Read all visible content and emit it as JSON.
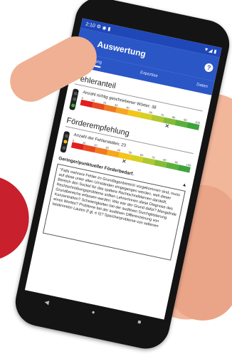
{
  "status": {
    "time": "2:10",
    "icons": "⚙ ◉ ▮",
    "right": "▼◢ ▮"
  },
  "appbar": {
    "back": "←",
    "title": "Auswertung",
    "help": "?"
  },
  "tabs": [
    {
      "label": "Normierung",
      "active": true
    },
    {
      "label": "Expertise",
      "active": false
    },
    {
      "label": "Daten",
      "active": false
    }
  ],
  "fehleranteil": {
    "title": "Fehleranteil",
    "label": "Anzahl richtig geschriebener Wörter: 38",
    "ticks": [
      "0",
      "10",
      "20",
      "30",
      "40",
      "50",
      "60",
      "70",
      "80",
      "90",
      "100"
    ],
    "marker_percent": 80,
    "light": "green"
  },
  "foerder": {
    "title": "Förderempfehlung",
    "label": "Anzahl der Fehlerstellen: 23",
    "ticks": [
      "0",
      "10",
      "20",
      "30",
      "40",
      "50",
      "60",
      "70",
      "80",
      "90",
      "100"
    ],
    "marker_percent": 48,
    "light": "yellow",
    "result": "Geringer/punktueller Förderbedarf.",
    "expand": "▲"
  },
  "textbox": "\"Falls mehrere Fehler im Grundlagenbereich vorgekommen sind, muss auf diese unter allen Umständen eingegangen werden, weil dieser Bereich den Sockel für das spätere Rechtschreiblernen darstellt. Rechtschreibungsprobleme sollten Lehrer/innen diese Diagnose des Grundbereichs erfassen werden: Wie war der Grund dafür? Mangelnde Konzentration? Schwierigkeiten bei der auditiven Durchgliederung eines Wortes? Probleme bei der auditiven Differenzierung von bestimmten Lauten (f gl, e ö)? Speicherprobleme von seltenen",
  "navbar": {
    "back": "◀",
    "home": "●",
    "recent": "■"
  },
  "colors": {
    "appbar": "#2a56c6",
    "status": "#1f47b8",
    "swoosh": "#c8202c",
    "skin": "#f2b69a"
  }
}
